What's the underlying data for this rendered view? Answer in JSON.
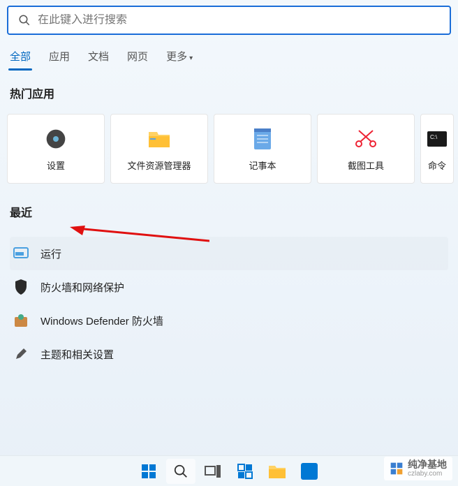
{
  "search": {
    "placeholder": "在此键入进行搜索"
  },
  "tabs": {
    "all": "全部",
    "apps": "应用",
    "docs": "文档",
    "web": "网页",
    "more": "更多"
  },
  "sections": {
    "popular": "热门应用",
    "recent": "最近"
  },
  "tiles": [
    {
      "label": "设置",
      "icon": "settings"
    },
    {
      "label": "文件资源管理器",
      "icon": "explorer"
    },
    {
      "label": "记事本",
      "icon": "notepad"
    },
    {
      "label": "截图工具",
      "icon": "snip"
    },
    {
      "label": "命令",
      "icon": "cmd"
    }
  ],
  "recent": [
    {
      "label": "运行",
      "icon": "run"
    },
    {
      "label": "防火墙和网络保护",
      "icon": "shield"
    },
    {
      "label": "Windows Defender 防火墙",
      "icon": "defender"
    },
    {
      "label": "主题和相关设置",
      "icon": "theme"
    }
  ],
  "watermark": {
    "name": "纯净基地",
    "url": "czlaby.com"
  }
}
